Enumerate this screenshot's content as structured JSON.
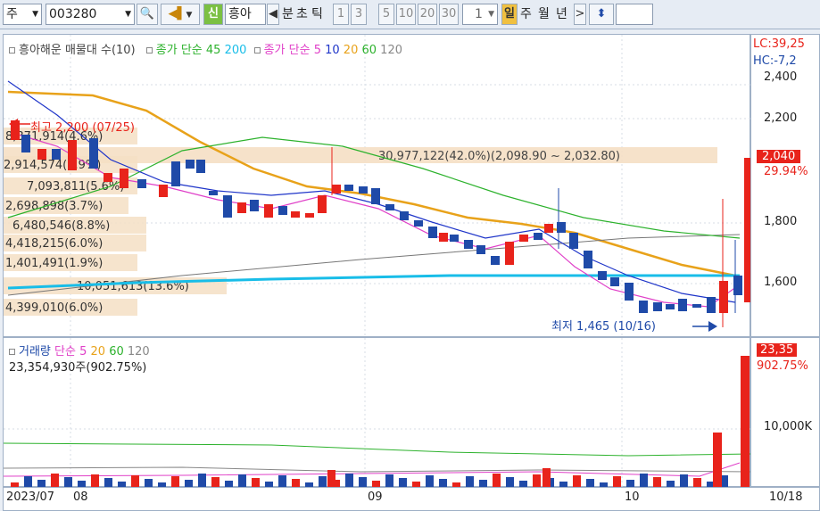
{
  "toolbar": {
    "type_value": "주",
    "code_value": "003280",
    "sin_label": "신",
    "name_value": "흥아",
    "bun_label": "분",
    "cho_label": "초",
    "tick_label": "틱",
    "intervals": [
      "1",
      "3",
      "5",
      "10",
      "20",
      "30"
    ],
    "period_value": "1",
    "day_label": "일",
    "week_label": "주",
    "month_label": "월",
    "year_label": "년"
  },
  "price_chart": {
    "legend_stock": "흥아해운 매물대 수(10)",
    "legend_ma_label": "종가 단순",
    "legend_ma_a": "45",
    "legend_ma_b": "200",
    "legend_ma2_label": "종가 단순",
    "legend_ma2_a": "5",
    "legend_ma2_b": "10",
    "legend_ma2_c": "20",
    "legend_ma2_d": "60",
    "legend_ma2_e": "120",
    "high_label": "최고 2,200 (07/25)",
    "low_label": "최저 1,465 (10/16)",
    "range_label": "30,977,122(42.0%)(2,098.90 ~ 2,032.80)",
    "volume_profile": [
      "8,871,914(4.6%)",
      "2,914,574(3.9%)",
      "7,093,811(5.6%)",
      "2,698,898(3.7%)",
      "6,480,546(8.8%)",
      "4,418,215(6.0%)",
      "1,401,491(1.9%)",
      "10,051,613(13.6%)",
      "4,399,010(6.0%)"
    ],
    "lc_label": "LC:39,25",
    "hc_label": "HC:-7,2",
    "price_ticks": [
      "2,400",
      "2,200",
      "1,800",
      "1,600"
    ],
    "current_price": "2,040",
    "current_vol_pct": "29.94%"
  },
  "volume_chart": {
    "legend_title": "거래량",
    "legend_ma_label": "단순",
    "legend_a": "5",
    "legend_b": "20",
    "legend_c": "60",
    "legend_d": "120",
    "summary": "23,354,930주(902.75%)",
    "tick": "10,000K",
    "current_value": "23,35",
    "current_pct": "902.75%"
  },
  "x_axis": {
    "labels": [
      "2023/07",
      "08",
      "09",
      "10"
    ],
    "last_date": "10/18"
  },
  "colors": {
    "up": "#e8231b",
    "down": "#1f4aa8",
    "ma45": "#2db22d",
    "ma200": "#777777",
    "ma5": "#e040c8",
    "ma10": "#1f35c9",
    "ma20": "#e8a21a",
    "ma60": "#2db22d",
    "ma120": "#888888",
    "cyan": "#18bde8"
  }
}
